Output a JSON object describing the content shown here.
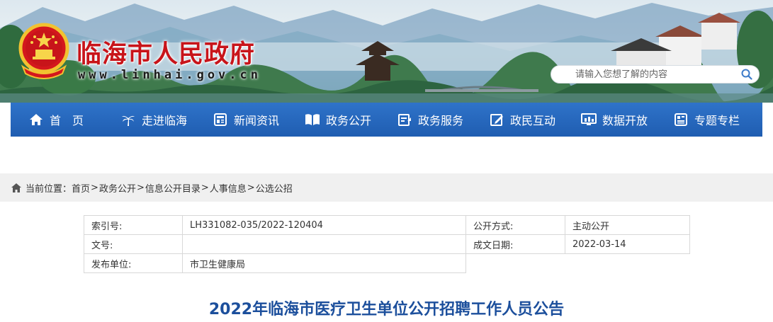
{
  "header": {
    "site_title": "临海市人民政府",
    "site_url": "www.linhai.gov.cn",
    "emblem": "national-emblem",
    "search": {
      "placeholder": "请输入您想了解的内容",
      "icon": "search-icon"
    }
  },
  "nav": {
    "items": [
      {
        "label": "首　页",
        "icon": "home-icon"
      },
      {
        "label": "走进临海",
        "icon": "palm-tree-icon"
      },
      {
        "label": "新闻资讯",
        "icon": "news-icon"
      },
      {
        "label": "政务公开",
        "icon": "book-icon"
      },
      {
        "label": "政务服务",
        "icon": "service-icon"
      },
      {
        "label": "政民互动",
        "icon": "edit-icon"
      },
      {
        "label": "数据开放",
        "icon": "data-chart-icon"
      },
      {
        "label": "专题专栏",
        "icon": "topic-icon"
      }
    ]
  },
  "breadcrumb": {
    "prefix": "当前位置：",
    "items": [
      "首页",
      "政务公开",
      "信息公开目录",
      "人事信息",
      "公选公招"
    ],
    "separator": ">"
  },
  "meta": {
    "index_label": "索引号:",
    "index_value": "LH331082-035/2022-120404",
    "open_mode_label": "公开方式:",
    "open_mode_value": "主动公开",
    "doc_no_label": "文号:",
    "doc_no_value": "",
    "date_label": "成文日期:",
    "date_value": "2022-03-14",
    "publisher_label": "发布单位:",
    "publisher_value": "市卫生健康局"
  },
  "article": {
    "title": "2022年临海市医疗卫生单位公开招聘工作人员公告"
  },
  "colors": {
    "nav_bg": "#2a6cc2",
    "title_red": "#c8141a",
    "article_title_blue": "#1c4f9c",
    "breadcrumb_bg": "#f0f0f0"
  }
}
